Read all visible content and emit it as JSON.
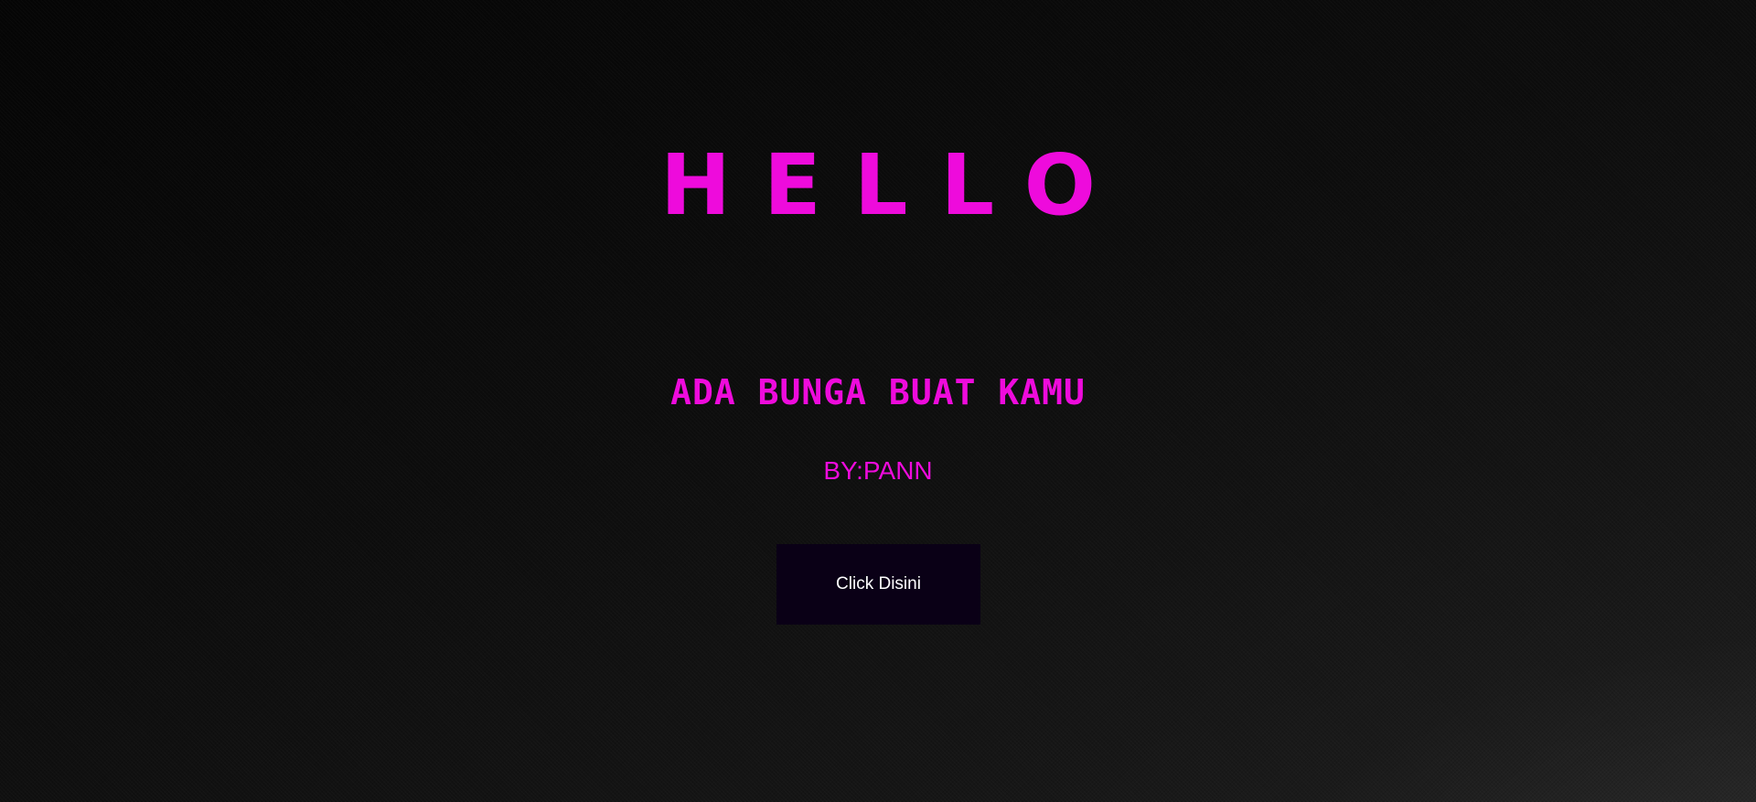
{
  "colors": {
    "accent": "#ee0bdc",
    "button_bg": "#0a0016",
    "button_text": "#ffffff"
  },
  "hero": {
    "title": "HELLO",
    "subtitle": "ADA BUNGA BUAT KAMU",
    "byline": "BY:PANN"
  },
  "actions": {
    "primary_label": "Click Disini"
  }
}
